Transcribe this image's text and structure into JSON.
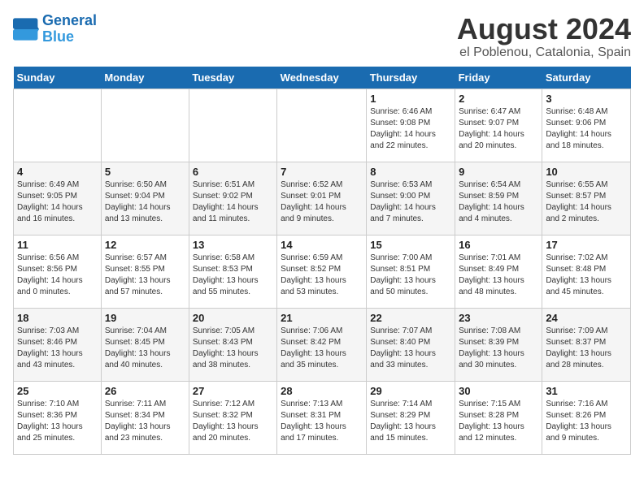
{
  "logo": {
    "line1": "General",
    "line2": "Blue"
  },
  "title": "August 2024",
  "subtitle": "el Poblenou, Catalonia, Spain",
  "days_of_week": [
    "Sunday",
    "Monday",
    "Tuesday",
    "Wednesday",
    "Thursday",
    "Friday",
    "Saturday"
  ],
  "weeks": [
    [
      {
        "day": "",
        "detail": ""
      },
      {
        "day": "",
        "detail": ""
      },
      {
        "day": "",
        "detail": ""
      },
      {
        "day": "",
        "detail": ""
      },
      {
        "day": "1",
        "detail": "Sunrise: 6:46 AM\nSunset: 9:08 PM\nDaylight: 14 hours\nand 22 minutes."
      },
      {
        "day": "2",
        "detail": "Sunrise: 6:47 AM\nSunset: 9:07 PM\nDaylight: 14 hours\nand 20 minutes."
      },
      {
        "day": "3",
        "detail": "Sunrise: 6:48 AM\nSunset: 9:06 PM\nDaylight: 14 hours\nand 18 minutes."
      }
    ],
    [
      {
        "day": "4",
        "detail": "Sunrise: 6:49 AM\nSunset: 9:05 PM\nDaylight: 14 hours\nand 16 minutes."
      },
      {
        "day": "5",
        "detail": "Sunrise: 6:50 AM\nSunset: 9:04 PM\nDaylight: 14 hours\nand 13 minutes."
      },
      {
        "day": "6",
        "detail": "Sunrise: 6:51 AM\nSunset: 9:02 PM\nDaylight: 14 hours\nand 11 minutes."
      },
      {
        "day": "7",
        "detail": "Sunrise: 6:52 AM\nSunset: 9:01 PM\nDaylight: 14 hours\nand 9 minutes."
      },
      {
        "day": "8",
        "detail": "Sunrise: 6:53 AM\nSunset: 9:00 PM\nDaylight: 14 hours\nand 7 minutes."
      },
      {
        "day": "9",
        "detail": "Sunrise: 6:54 AM\nSunset: 8:59 PM\nDaylight: 14 hours\nand 4 minutes."
      },
      {
        "day": "10",
        "detail": "Sunrise: 6:55 AM\nSunset: 8:57 PM\nDaylight: 14 hours\nand 2 minutes."
      }
    ],
    [
      {
        "day": "11",
        "detail": "Sunrise: 6:56 AM\nSunset: 8:56 PM\nDaylight: 14 hours\nand 0 minutes."
      },
      {
        "day": "12",
        "detail": "Sunrise: 6:57 AM\nSunset: 8:55 PM\nDaylight: 13 hours\nand 57 minutes."
      },
      {
        "day": "13",
        "detail": "Sunrise: 6:58 AM\nSunset: 8:53 PM\nDaylight: 13 hours\nand 55 minutes."
      },
      {
        "day": "14",
        "detail": "Sunrise: 6:59 AM\nSunset: 8:52 PM\nDaylight: 13 hours\nand 53 minutes."
      },
      {
        "day": "15",
        "detail": "Sunrise: 7:00 AM\nSunset: 8:51 PM\nDaylight: 13 hours\nand 50 minutes."
      },
      {
        "day": "16",
        "detail": "Sunrise: 7:01 AM\nSunset: 8:49 PM\nDaylight: 13 hours\nand 48 minutes."
      },
      {
        "day": "17",
        "detail": "Sunrise: 7:02 AM\nSunset: 8:48 PM\nDaylight: 13 hours\nand 45 minutes."
      }
    ],
    [
      {
        "day": "18",
        "detail": "Sunrise: 7:03 AM\nSunset: 8:46 PM\nDaylight: 13 hours\nand 43 minutes."
      },
      {
        "day": "19",
        "detail": "Sunrise: 7:04 AM\nSunset: 8:45 PM\nDaylight: 13 hours\nand 40 minutes."
      },
      {
        "day": "20",
        "detail": "Sunrise: 7:05 AM\nSunset: 8:43 PM\nDaylight: 13 hours\nand 38 minutes."
      },
      {
        "day": "21",
        "detail": "Sunrise: 7:06 AM\nSunset: 8:42 PM\nDaylight: 13 hours\nand 35 minutes."
      },
      {
        "day": "22",
        "detail": "Sunrise: 7:07 AM\nSunset: 8:40 PM\nDaylight: 13 hours\nand 33 minutes."
      },
      {
        "day": "23",
        "detail": "Sunrise: 7:08 AM\nSunset: 8:39 PM\nDaylight: 13 hours\nand 30 minutes."
      },
      {
        "day": "24",
        "detail": "Sunrise: 7:09 AM\nSunset: 8:37 PM\nDaylight: 13 hours\nand 28 minutes."
      }
    ],
    [
      {
        "day": "25",
        "detail": "Sunrise: 7:10 AM\nSunset: 8:36 PM\nDaylight: 13 hours\nand 25 minutes."
      },
      {
        "day": "26",
        "detail": "Sunrise: 7:11 AM\nSunset: 8:34 PM\nDaylight: 13 hours\nand 23 minutes."
      },
      {
        "day": "27",
        "detail": "Sunrise: 7:12 AM\nSunset: 8:32 PM\nDaylight: 13 hours\nand 20 minutes."
      },
      {
        "day": "28",
        "detail": "Sunrise: 7:13 AM\nSunset: 8:31 PM\nDaylight: 13 hours\nand 17 minutes."
      },
      {
        "day": "29",
        "detail": "Sunrise: 7:14 AM\nSunset: 8:29 PM\nDaylight: 13 hours\nand 15 minutes."
      },
      {
        "day": "30",
        "detail": "Sunrise: 7:15 AM\nSunset: 8:28 PM\nDaylight: 13 hours\nand 12 minutes."
      },
      {
        "day": "31",
        "detail": "Sunrise: 7:16 AM\nSunset: 8:26 PM\nDaylight: 13 hours\nand 9 minutes."
      }
    ]
  ]
}
